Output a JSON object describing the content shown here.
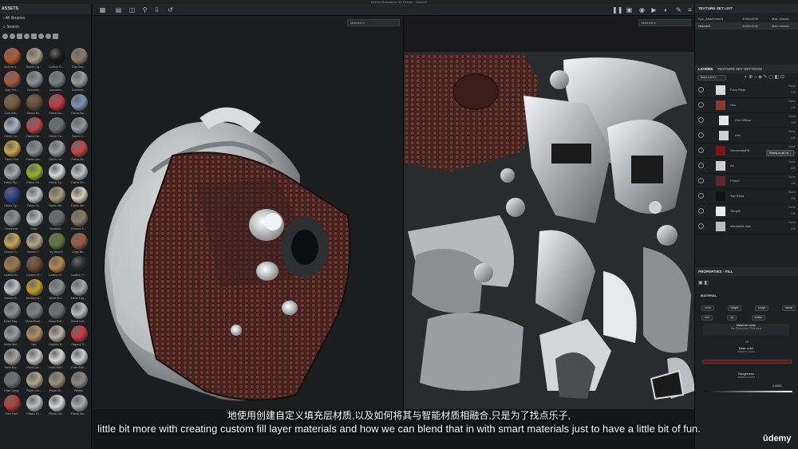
{
  "window_title": "Helmet-Substance 3D Painter - Helmet*",
  "assets": {
    "header": "ASSETS",
    "library": "All libraries",
    "search_placeholder": "Search",
    "materials": [
      "Autumn L...",
      "Baked Lig...",
      "Carbon Fi...",
      "Clay Earl...",
      "Clay Terr...",
      "Concrete...",
      "Concrete...",
      "Concrete...",
      "Cork Adh...",
      "Denim Ri...",
      "Fabric Ba...",
      "Fabric Ba...",
      "Fabric Ca...",
      "Fabric De...",
      "Fabric Kn...",
      "Fabric Li...",
      "Fabric Felt",
      "Fabric Lea...",
      "Fabric Lin...",
      "Fabric Ny...",
      "Fabric Rip...",
      "Fabric Se...",
      "Fabric Sp...",
      "Fabric Su...",
      "Fabric Sp...",
      "Fabric Ta...",
      "Fabric We...",
      "Fabric We...",
      "Footprints",
      "Glass",
      "Gouache...",
      "Ground S...",
      "Ground S...",
      "Human F...",
      "Ivy Branch",
      "Large Bri...",
      "Leather B...",
      "Leather B...",
      "Leather S...",
      "Leather S...",
      "Marble Fi...",
      "Medium A...",
      "Metal Bru...",
      "Metal Edg...",
      "Metal Edg...",
      "Metal Rusti...",
      "Metal Roll...",
      "Metal Sof...",
      "Metal Wal...",
      "Nail",
      "Organic B...",
      "Organic F...",
      "Paint Bru...",
      "Paint Cra...",
      "Paint Roll...",
      "Paint Roll...",
      "Paint Spray",
      "Paper Cra...",
      "Paper Gr...",
      "Pebble",
      "Pine Park",
      "Plastic Gr...",
      "Plastic Gri...",
      "Plastic Ma..."
    ],
    "material_colors": [
      "#b8562e",
      "#a89a86",
      "#1a1a1a",
      "#8e7b6a",
      "#a5583e",
      "#8e8f91",
      "#7d7e80",
      "#9a9b9c",
      "#7a5a3a",
      "#6a4a36",
      "#c23b40",
      "#7c94b0",
      "#aab2c2",
      "#b7474f",
      "#6e6e70",
      "#93979c",
      "#c9a54e",
      "#8c8f92",
      "#9c9ea2",
      "#c7444a",
      "#a6a8ab",
      "#9bb226",
      "#d5d7da",
      "#bfc1c4",
      "#2c3f8a",
      "#c0c2c4",
      "#a59a7a",
      "#d8cdb8",
      "#8f9092",
      "#babcbf",
      "#6a6b6d",
      "#8c7d6a",
      "#c8a35a",
      "#b9a48a",
      "#5d7a3a",
      "#9c5a40",
      "#9e7a4a",
      "#6d4a2e",
      "#b5864a",
      "#2a2a2c",
      "#c3c4c6",
      "#c39a2a",
      "#8c8d8f",
      "#a7a9ab",
      "#8e8f91",
      "#7f8082",
      "#6e6f71",
      "#b8bbbe",
      "#9a9c9f",
      "#ad8f5f",
      "#b8b0a0",
      "#c33d42",
      "#a6a5a3",
      "#c8c6c1",
      "#d6d5d2",
      "#cfcfcf",
      "#6f7072",
      "#b0a48c",
      "#9a8f7b",
      "#8b8883",
      "#b23c3c",
      "#bfbfbf",
      "#d8d8d8",
      "#a8aaad"
    ]
  },
  "viewport": {
    "left_dropdown": "Material",
    "right_dropdown": "Material"
  },
  "texture_set_list": {
    "header": "TEXTURE SET LIST",
    "sets": [
      {
        "name": "Eye_Attachment1",
        "res": "4096x4096",
        "shader": "Main shader"
      },
      {
        "name": "Helmet1",
        "res": "4096x4096",
        "shader": "Main shader"
      }
    ]
  },
  "layers": {
    "tab_layers": "LAYERS",
    "tab_settings": "TEXTURE SET SETTINGS",
    "channel": "Base color",
    "items": [
      {
        "name": "Face Plate",
        "mode": "Norm",
        "opacity": "100"
      },
      {
        "name": "Hex",
        "mode": "Norm",
        "opacity": "100"
      },
      {
        "name": "Hex Diffuse",
        "mode": "Norm",
        "opacity": "100"
      },
      {
        "name": "Hex",
        "mode": "Norm",
        "opacity": "100"
      },
      {
        "name": "SecondaryFill",
        "mode": "Norm",
        "opacity": "100"
      },
      {
        "name": "Ao",
        "mode": "Norm",
        "opacity": "100"
      },
      {
        "name": "Frame",
        "mode": "Norm",
        "opacity": "100"
      },
      {
        "name": "Top Head",
        "mode": "Norm",
        "opacity": "100"
      },
      {
        "name": "Temple",
        "mode": "Norm",
        "opacity": "100"
      },
      {
        "name": "Mandable Jaw",
        "mode": "Norm",
        "opacity": "100"
      }
    ],
    "tooltip": "Ready to all ch..."
  },
  "properties": {
    "header": "PROPERTIES - FILL",
    "material_label": "MATERIAL",
    "channels_row1": [
      "color",
      "height",
      "rough",
      "metal"
    ],
    "channels_row2": [
      "nrm",
      "op",
      "emiss"
    ],
    "material_mode": "Material mode",
    "no_resource": "No Resource Selected",
    "or": "Or",
    "base_color": "Base color",
    "uniform_color": "uniform color",
    "base_color_swatch": "#6a1318",
    "roughness": "Roughness",
    "roughness_sub": "uniform color",
    "roughness_value": "0.0863"
  },
  "subtitles": {
    "chinese": "地使用创建自定义填充层材质,以及如何将其与智能材质相融合,只是为了找点乐子,",
    "english": "little bit more with creating custom fill layer materials and how we can blend that in with smart materials just to have a little bit of fun."
  },
  "watermark": "ûdemy"
}
